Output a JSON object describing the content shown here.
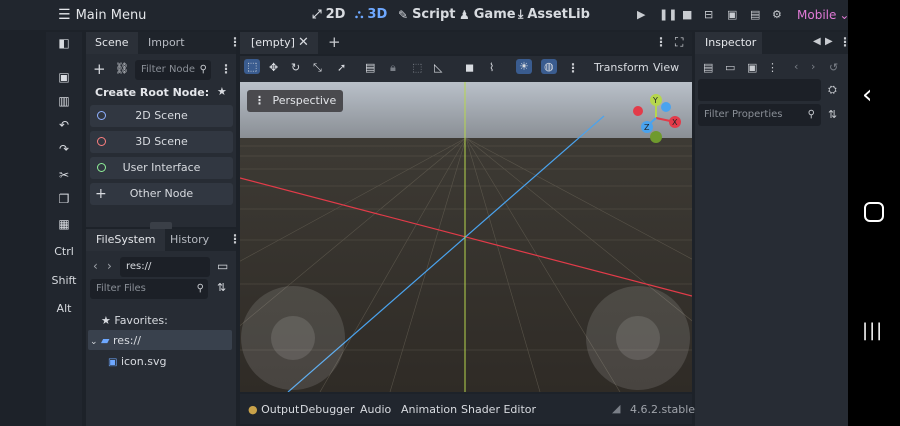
{
  "topbar": {
    "main_menu": "Main Menu",
    "tabs": [
      {
        "label": "2D",
        "icon": "2d-icon"
      },
      {
        "label": "3D",
        "icon": "3d-icon",
        "active": true
      },
      {
        "label": "Script",
        "icon": "script-icon"
      },
      {
        "label": "Game",
        "icon": "game-icon"
      },
      {
        "label": "AssetLib",
        "icon": "assetlib-icon"
      }
    ],
    "renderer": "Mobile"
  },
  "left_toolbar": {
    "labels": {
      "ctrl": "Ctrl",
      "shift": "Shift",
      "alt": "Alt"
    }
  },
  "scene_dock": {
    "tabs": [
      "Scene",
      "Import"
    ],
    "filter_placeholder": "Filter Node",
    "create_root_label": "Create Root Node:",
    "root_buttons": [
      {
        "label": "2D Scene",
        "color": "#8fb0ff"
      },
      {
        "label": "3D Scene",
        "color": "#fc7f7f"
      },
      {
        "label": "User Interface",
        "color": "#8eef97"
      },
      {
        "label": "Other Node",
        "color": "#d8dbe0"
      }
    ]
  },
  "filesystem_dock": {
    "tabs": [
      "FileSystem",
      "History"
    ],
    "path": "res://",
    "filter_placeholder": "Filter Files",
    "favorites_label": "Favorites:",
    "root_folder": "res://",
    "files": [
      "icon.svg"
    ]
  },
  "viewport": {
    "tab_label": "[empty]",
    "toolbar": {
      "transform": "Transform",
      "view": "View"
    },
    "perspective_label": "Perspective",
    "gizmo_axes": {
      "x": "X",
      "y": "Y",
      "z": "Z"
    },
    "colors": {
      "x_axis": "#e33b49",
      "z_axis": "#4aa3ee",
      "y_axis": "#b6d64d"
    }
  },
  "bottom_panel": {
    "tabs": [
      "Output",
      "Debugger",
      "Audio",
      "Animation",
      "Shader Editor"
    ],
    "version": "4.6.2.stable"
  },
  "inspector": {
    "tab_label": "Inspector",
    "filter_placeholder": "Filter Properties"
  }
}
